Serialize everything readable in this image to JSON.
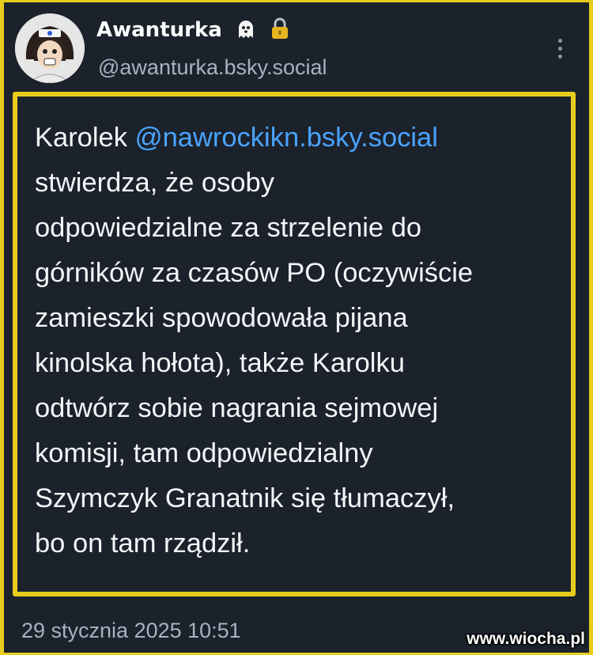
{
  "author": {
    "display_name": "Awanturka",
    "handle": "@awanturka.bsky.social",
    "name_icons": [
      "ghost-icon",
      "lock-icon"
    ]
  },
  "post": {
    "lines": [
      {
        "pre": "Karolek ",
        "mention": "@nawrockikn.bsky.social"
      },
      {
        "pre": " stwierdza, że osoby",
        "mention": ""
      },
      {
        "pre": "odpowiedzialne za strzelenie do",
        "mention": ""
      },
      {
        "pre": "górników za czasów PO (oczywiście",
        "mention": ""
      },
      {
        "pre": "zamieszki spowodowała pijana",
        "mention": ""
      },
      {
        "pre": "kinolska hołota), także Karolku",
        "mention": ""
      },
      {
        "pre": "odtwórz sobie nagrania sejmowej",
        "mention": ""
      },
      {
        "pre": "komisji, tam odpowiedzialny",
        "mention": ""
      },
      {
        "pre": "Szymczyk Granatnik się tłumaczył,",
        "mention": ""
      },
      {
        "pre": "bo on tam rządził.",
        "mention": ""
      }
    ]
  },
  "timestamp": "29 stycznia 2025 10:51",
  "watermark": "www.wiocha.pl",
  "colors": {
    "background": "#1b222c",
    "frame": "#e8cc1c",
    "mention": "#4aa3ff",
    "text": "#f3f5f7",
    "muted": "#a8b2bf"
  }
}
